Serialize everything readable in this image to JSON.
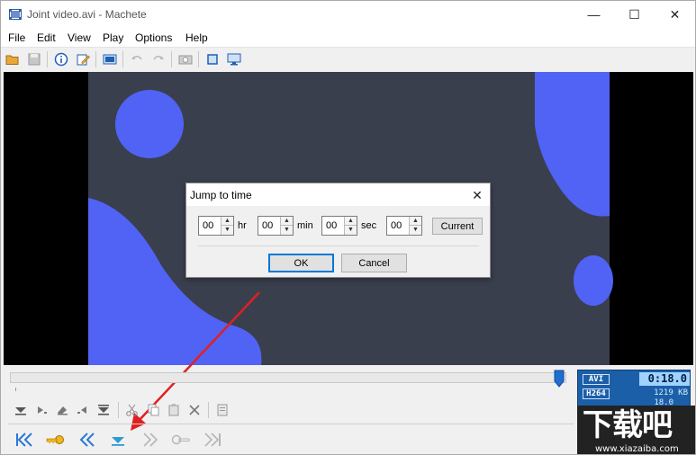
{
  "window": {
    "title": "Joint video.avi - Machete",
    "minimize_glyph": "—",
    "maximize_glyph": "☐",
    "close_glyph": "✕"
  },
  "menu": [
    {
      "label": "File"
    },
    {
      "label": "Edit"
    },
    {
      "label": "View"
    },
    {
      "label": "Play"
    },
    {
      "label": "Options"
    },
    {
      "label": "Help"
    }
  ],
  "toolbar_icons": [
    "open-folder-icon",
    "save-icon",
    "info-icon",
    "edit-tags-icon",
    "video-frames-icon",
    "undo-icon",
    "redo-icon",
    "camera-icon",
    "crop-icon",
    "monitor-icon"
  ],
  "dialog": {
    "title": "Jump to time",
    "close_glyph": "✕",
    "hours": "00",
    "hours_unit": "hr",
    "minutes": "00",
    "minutes_unit": "min",
    "seconds": "00",
    "seconds_unit": "sec",
    "frames": "00",
    "current_label": "Current",
    "ok_label": "OK",
    "cancel_label": "Cancel"
  },
  "seek": {
    "position": 0.995
  },
  "edit_icons": [
    "mark-in-icon",
    "mark-out-icon",
    "eraser-icon",
    "select-back-icon",
    "mark-end-icon",
    "cut-icon",
    "copy-icon",
    "paste-icon",
    "delete-icon",
    "properties-icon"
  ],
  "play_icons": [
    "go-to-start-icon",
    "keyframe-back-icon",
    "rewind-icon",
    "play-marker-icon",
    "forward-icon",
    "keyframe-forward-icon",
    "go-to-end-icon"
  ],
  "info": {
    "container": "AVI",
    "codec": "H264",
    "time": "0:18.0",
    "size": "1219 KB",
    "position_time": "18.0"
  },
  "watermark": {
    "text": "下载吧",
    "url": "www.xiazaiba.com"
  },
  "colors": {
    "blob_blue": "#5163f5",
    "frame_bg": "#3a3f4e",
    "arrow_red": "#e02020",
    "accent_blue": "#0078d7"
  }
}
